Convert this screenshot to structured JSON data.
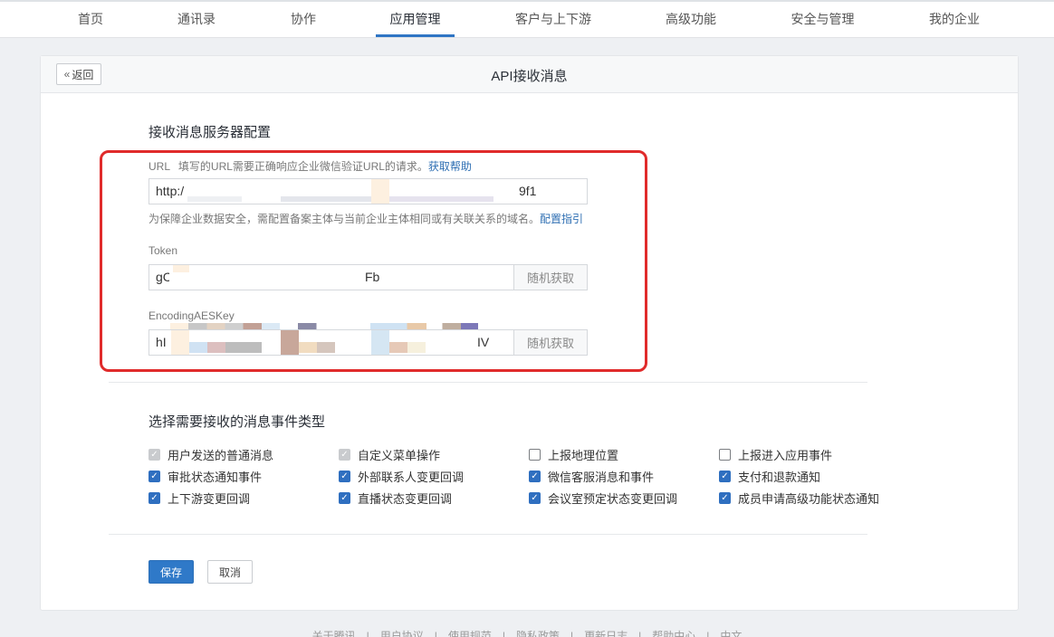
{
  "nav": {
    "items": [
      "首页",
      "通讯录",
      "协作",
      "应用管理",
      "客户与上下游",
      "高级功能",
      "安全与管理",
      "我的企业"
    ],
    "active_index": 3
  },
  "header": {
    "back_label": "返回",
    "title": "API接收消息"
  },
  "server_config": {
    "section_title": "接收消息服务器配置",
    "url_label": "URL",
    "url_hint": "填写的URL需要正确响应企业微信验证URL的请求。",
    "url_help_link": "获取帮助",
    "url_value_start": "http:/",
    "url_value_end": "9f1",
    "domain_note": "为保障企业数据安全，需配置备案主体与当前企业主体相同或有关联关系的域名。",
    "domain_link": "配置指引",
    "token_label": "Token",
    "token_value_start": "gC",
    "token_value_end": "Fb",
    "token_button": "随机获取",
    "aes_label": "EncodingAESKey",
    "aes_value_start": "hI",
    "aes_value_end": "IV",
    "aes_button": "随机获取"
  },
  "events": {
    "section_title": "选择需要接收的消息事件类型",
    "items": [
      {
        "label": "用户发送的普通消息",
        "state": "disabled"
      },
      {
        "label": "自定义菜单操作",
        "state": "disabled"
      },
      {
        "label": "上报地理位置",
        "state": "unchecked"
      },
      {
        "label": "上报进入应用事件",
        "state": "unchecked"
      },
      {
        "label": "审批状态通知事件",
        "state": "checked"
      },
      {
        "label": "外部联系人变更回调",
        "state": "checked"
      },
      {
        "label": "微信客服消息和事件",
        "state": "checked"
      },
      {
        "label": "支付和退款通知",
        "state": "checked"
      },
      {
        "label": "上下游变更回调",
        "state": "checked"
      },
      {
        "label": "直播状态变更回调",
        "state": "checked"
      },
      {
        "label": "会议室预定状态变更回调",
        "state": "checked"
      },
      {
        "label": "成员申请高级功能状态通知",
        "state": "checked"
      }
    ]
  },
  "actions": {
    "save_label": "保存",
    "cancel_label": "取消"
  },
  "footer": {
    "links": [
      "关于腾讯",
      "用户协议",
      "使用规范",
      "隐私政策",
      "更新日志",
      "帮助中心",
      "中文"
    ]
  },
  "colors": {
    "accent": "#2f79c8",
    "highlight_box": "#e02b2b"
  }
}
